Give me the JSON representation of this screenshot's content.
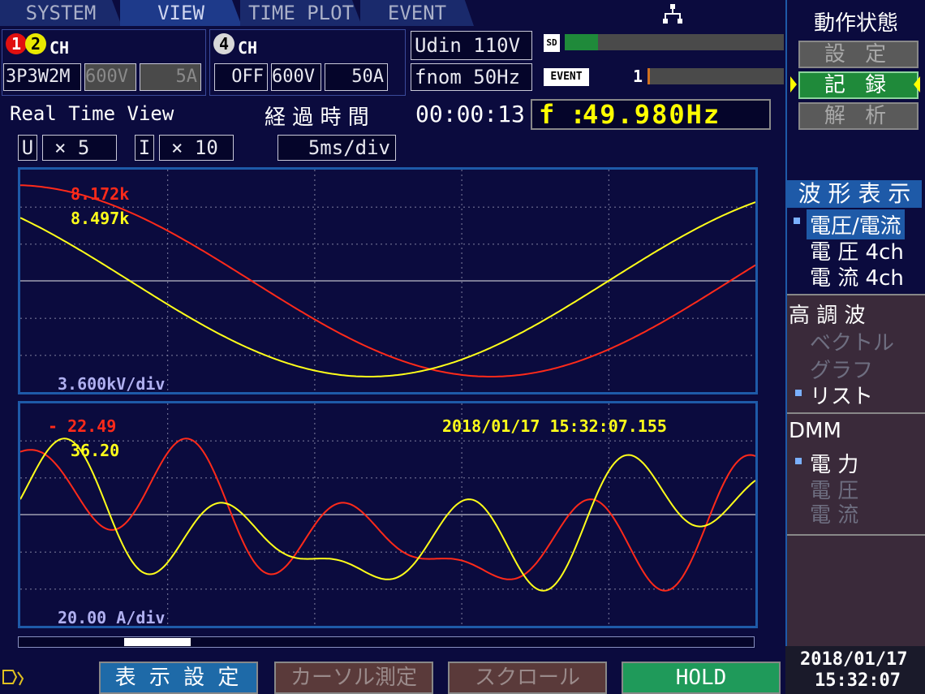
{
  "tabs": [
    "SYSTEM",
    "VIEW",
    "TIME PLOT",
    "EVENT"
  ],
  "active_tab": "VIEW",
  "ch12": {
    "icon1": "1",
    "icon2": "2",
    "label": "CH",
    "wiring": "3P3W2M",
    "volt_range": "600V",
    "curr_range": "5A"
  },
  "ch4": {
    "icon": "4",
    "label": "CH",
    "state": "OFF",
    "volt_range": "600V",
    "curr_range": "50A"
  },
  "udin": "Udin 110V",
  "fnom": "fnom  50Hz",
  "sd_label": "SD",
  "event_label": "EVENT",
  "event_count": "1",
  "network_icon": "network-icon",
  "view_title": "Real Time View",
  "elapsed_label": "経 過 時 間",
  "elapsed_time": "00:00:13",
  "freq_label": "f :",
  "freq_value": "49.980Hz",
  "zoom": {
    "u_label": "U",
    "u_value": "× 5",
    "i_label": "I",
    "i_value": "× 10",
    "timebase": "5ms/div"
  },
  "voltage_plot": {
    "red_value": "8.172k",
    "yellow_value": "8.497k",
    "scale": "3.600kV/div"
  },
  "current_plot": {
    "red_value": "- 22.49",
    "yellow_value": "36.20",
    "scale": "20.00 A/div",
    "timestamp": "2018/01/17  15:32:07.155"
  },
  "status_panel": {
    "title": "動作状態",
    "buttons": [
      "設 定",
      "記 録",
      "解 析"
    ],
    "active": "記 録"
  },
  "waveform_menu": {
    "title": "波 形 表 示",
    "items": [
      "電圧/電流",
      "電 圧 4ch",
      "電 流 4ch"
    ],
    "selected": "電圧/電流"
  },
  "harmonic_menu": {
    "title": "高 調 波",
    "items": [
      "ベクトル",
      "グラフ",
      "リスト"
    ],
    "selected": "リスト"
  },
  "dmm_menu": {
    "title": "DMM",
    "items": [
      "電 力",
      "電 圧",
      "電 流"
    ],
    "selected": "電 力"
  },
  "softkeys": [
    "表 示 設 定",
    "カーソル測定",
    "スクロール",
    "HOLD"
  ],
  "clock": {
    "date": "2018/01/17",
    "time": "15:32:07"
  },
  "colors": {
    "voltage_red": "#ff2a1a",
    "current_yellow": "#ffff1a",
    "accent_green": "#1f8a3a",
    "frame_blue": "#1e5aa8",
    "freq_yellow": "#ffff00"
  }
}
